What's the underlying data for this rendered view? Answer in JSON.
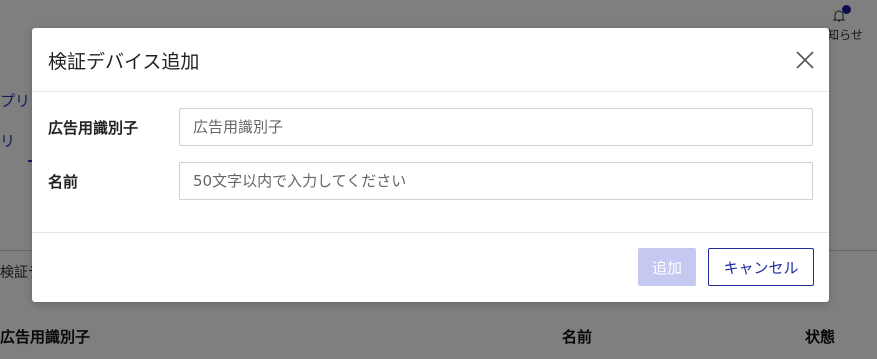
{
  "background": {
    "notification_label": "お知らせ",
    "side_text_1": "プリ",
    "side_text_2": "リ",
    "section_label": "検証デ",
    "table_headers": {
      "id": "広告用識別子",
      "name": "名前",
      "status": "状態"
    }
  },
  "modal": {
    "title": "検証デバイス追加",
    "fields": [
      {
        "label": "広告用識別子",
        "placeholder": "広告用識別子",
        "value": ""
      },
      {
        "label": "名前",
        "placeholder": "50文字以内で入力してください",
        "value": ""
      }
    ],
    "add_label": "追加",
    "cancel_label": "キャンセル"
  },
  "colors": {
    "accent": "#1f2d9e",
    "add_disabled": "#c5c8f0",
    "notification_dot": "#1a1aa0"
  },
  "icons": {
    "close": "close-icon",
    "bell": "bell-icon"
  }
}
